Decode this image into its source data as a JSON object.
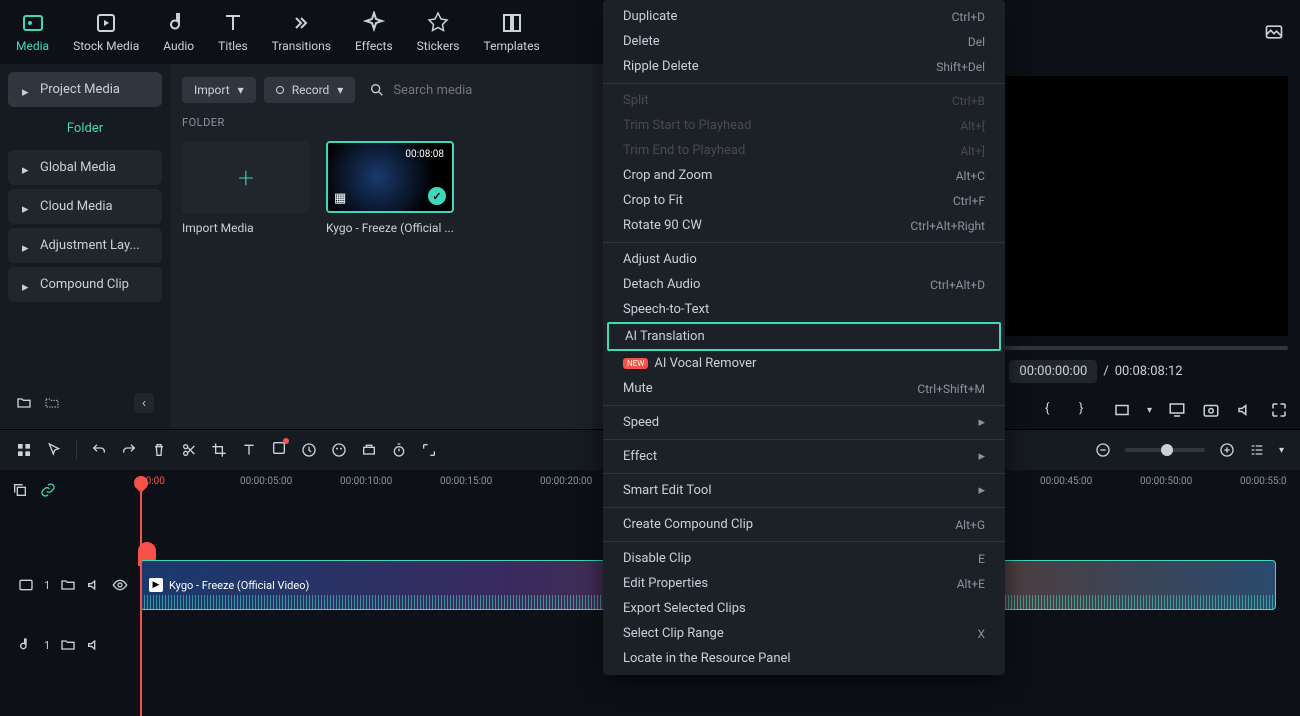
{
  "tabs": [
    {
      "label": "Media",
      "icon": "media"
    },
    {
      "label": "Stock Media",
      "icon": "stock"
    },
    {
      "label": "Audio",
      "icon": "audio"
    },
    {
      "label": "Titles",
      "icon": "titles"
    },
    {
      "label": "Transitions",
      "icon": "transitions"
    },
    {
      "label": "Effects",
      "icon": "effects"
    },
    {
      "label": "Stickers",
      "icon": "stickers"
    },
    {
      "label": "Templates",
      "icon": "templates"
    }
  ],
  "sidebar": {
    "project_media": "Project Media",
    "folder": "Folder",
    "items": [
      "Global Media",
      "Cloud Media",
      "Adjustment Lay...",
      "Compound Clip"
    ]
  },
  "media_toolbar": {
    "import": "Import",
    "record": "Record",
    "search_placeholder": "Search media"
  },
  "folder_label": "FOLDER",
  "media_items": [
    {
      "name": "Import Media",
      "type": "add"
    },
    {
      "name": "Kygo - Freeze (Official ...",
      "type": "clip",
      "duration": "00:08:08"
    }
  ],
  "preview": {
    "current": "00:00:00:00",
    "sep": "/",
    "total": "00:08:08:12"
  },
  "ruler": [
    "00:00",
    "00:00:05:00",
    "00:00:10:00",
    "00:00:15:00",
    "00:00:20:00",
    "",
    "",
    "",
    "",
    "00:00:45:00",
    "00:00:50:00",
    "00:00:55:0"
  ],
  "clip_title": "Kygo - Freeze (Official Video)",
  "track_v_num": "1",
  "track_a_num": "1",
  "context_menu": [
    {
      "label": "Duplicate",
      "shortcut": "Ctrl+D"
    },
    {
      "label": "Delete",
      "shortcut": "Del"
    },
    {
      "label": "Ripple Delete",
      "shortcut": "Shift+Del"
    },
    {
      "sep": true
    },
    {
      "label": "Split",
      "shortcut": "Ctrl+B",
      "disabled": true
    },
    {
      "label": "Trim Start to Playhead",
      "shortcut": "Alt+[",
      "disabled": true
    },
    {
      "label": "Trim End to Playhead",
      "shortcut": "Alt+]",
      "disabled": true
    },
    {
      "label": "Crop and Zoom",
      "shortcut": "Alt+C"
    },
    {
      "label": "Crop to Fit",
      "shortcut": "Ctrl+F"
    },
    {
      "label": "Rotate 90 CW",
      "shortcut": "Ctrl+Alt+Right"
    },
    {
      "sep": true
    },
    {
      "label": "Adjust Audio"
    },
    {
      "label": "Detach Audio",
      "shortcut": "Ctrl+Alt+D"
    },
    {
      "label": "Speech-to-Text"
    },
    {
      "label": "AI Translation",
      "highlighted": true
    },
    {
      "label": "AI Vocal Remover",
      "badge": "NEW"
    },
    {
      "label": "Mute",
      "shortcut": "Ctrl+Shift+M"
    },
    {
      "sep": true
    },
    {
      "label": "Speed",
      "submenu": true
    },
    {
      "sep": true
    },
    {
      "label": "Effect",
      "submenu": true
    },
    {
      "sep": true
    },
    {
      "label": "Smart Edit Tool",
      "submenu": true
    },
    {
      "sep": true
    },
    {
      "label": "Create Compound Clip",
      "shortcut": "Alt+G"
    },
    {
      "sep": true
    },
    {
      "label": "Disable Clip",
      "shortcut": "E"
    },
    {
      "label": "Edit Properties",
      "shortcut": "Alt+E"
    },
    {
      "label": "Export Selected Clips"
    },
    {
      "label": "Select Clip Range",
      "shortcut": "X"
    },
    {
      "label": "Locate in the Resource Panel"
    }
  ]
}
